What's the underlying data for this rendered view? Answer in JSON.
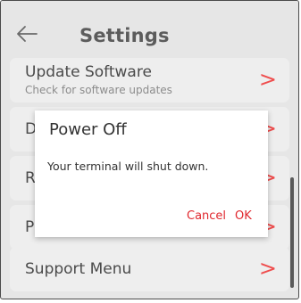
{
  "header": {
    "title": "Settings",
    "back_icon": "back-arrow-icon"
  },
  "items": [
    {
      "title": "Update Software",
      "subtitle": "Check for software updates"
    },
    {
      "title": "D"
    },
    {
      "title": "R"
    },
    {
      "title": "P"
    },
    {
      "title": "Support Menu"
    }
  ],
  "chevron": ">",
  "dialog": {
    "title": "Power Off",
    "message": "Your terminal will shut down.",
    "cancel_label": "Cancel",
    "ok_label": "OK"
  },
  "colors": {
    "accent": "#e0282e",
    "chevron": "#ef4d4d",
    "background": "#e6e6e6",
    "row": "#eeeeee"
  }
}
